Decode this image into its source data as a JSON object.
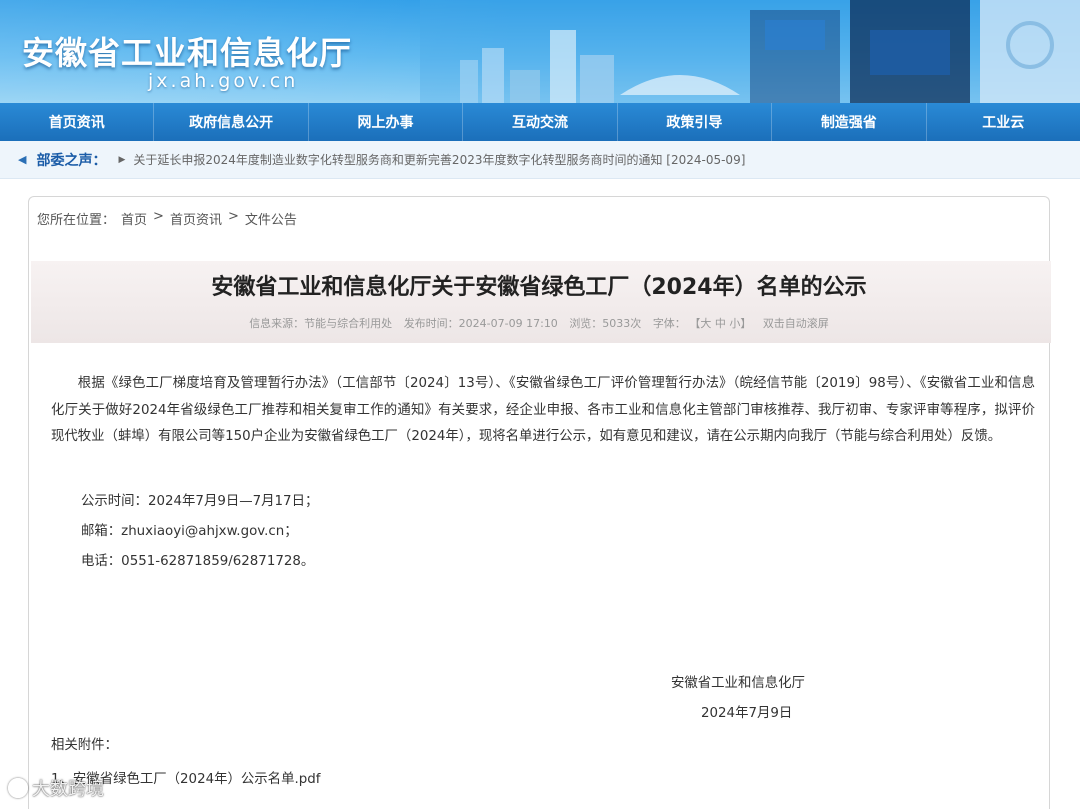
{
  "header": {
    "site_title": "安徽省工业和信息化厅",
    "site_domain": "jx.ah.gov.cn"
  },
  "nav": {
    "items": [
      "首页资讯",
      "政府信息公开",
      "网上办事",
      "互动交流",
      "政策引导",
      "制造强省",
      "工业云"
    ]
  },
  "ticker": {
    "label": "部委之声：",
    "text": "关于延长申报2024年度制造业数字化转型服务商和更新完善2023年度数字化转型服务商时间的通知 [2024-05-09]"
  },
  "breadcrumb": {
    "prefix": "您所在位置：",
    "items": [
      "首页",
      "首页资讯",
      "文件公告"
    ],
    "sep": ">"
  },
  "article": {
    "title": "安徽省工业和信息化厅关于安徽省绿色工厂（2024年）名单的公示",
    "meta": {
      "source": "信息来源：节能与综合利用处",
      "published": "发布时间：2024-07-09 17:10",
      "views": "浏览：5033次",
      "font_label": "字体：",
      "font_open": "【",
      "font_large": "大",
      "font_medium": "中",
      "font_small": "小",
      "font_close": "】",
      "autoscroll": "双击自动滚屏"
    },
    "body": "根据《绿色工厂梯度培育及管理暂行办法》（工信部节〔2024〕13号）、《安徽省绿色工厂评价管理暂行办法》（皖经信节能〔2019〕98号）、《安徽省工业和信息化厅关于做好2024年省级绿色工厂推荐和相关复审工作的通知》有关要求，经企业申报、各市工业和信息化主管部门审核推荐、我厅初审、专家评审等程序，拟评价现代牧业（蚌埠）有限公司等150户企业为安徽省绿色工厂（2024年），现将名单进行公示，如有意见和建议，请在公示期内向我厅（节能与综合利用处）反馈。",
    "period": "公示时间：2024年7月9日—7月17日；",
    "email": "邮箱：zhuxiaoyi@ahjxw.gov.cn；",
    "phone": "电话：0551-62871859/62871728。",
    "sign_org": "安徽省工业和信息化厅",
    "sign_date": "2024年7月9日",
    "attach_label": "相关附件：",
    "attachment": "1、安徽省绿色工厂（2024年）公示名单.pdf"
  },
  "watermark": "大数跨境"
}
